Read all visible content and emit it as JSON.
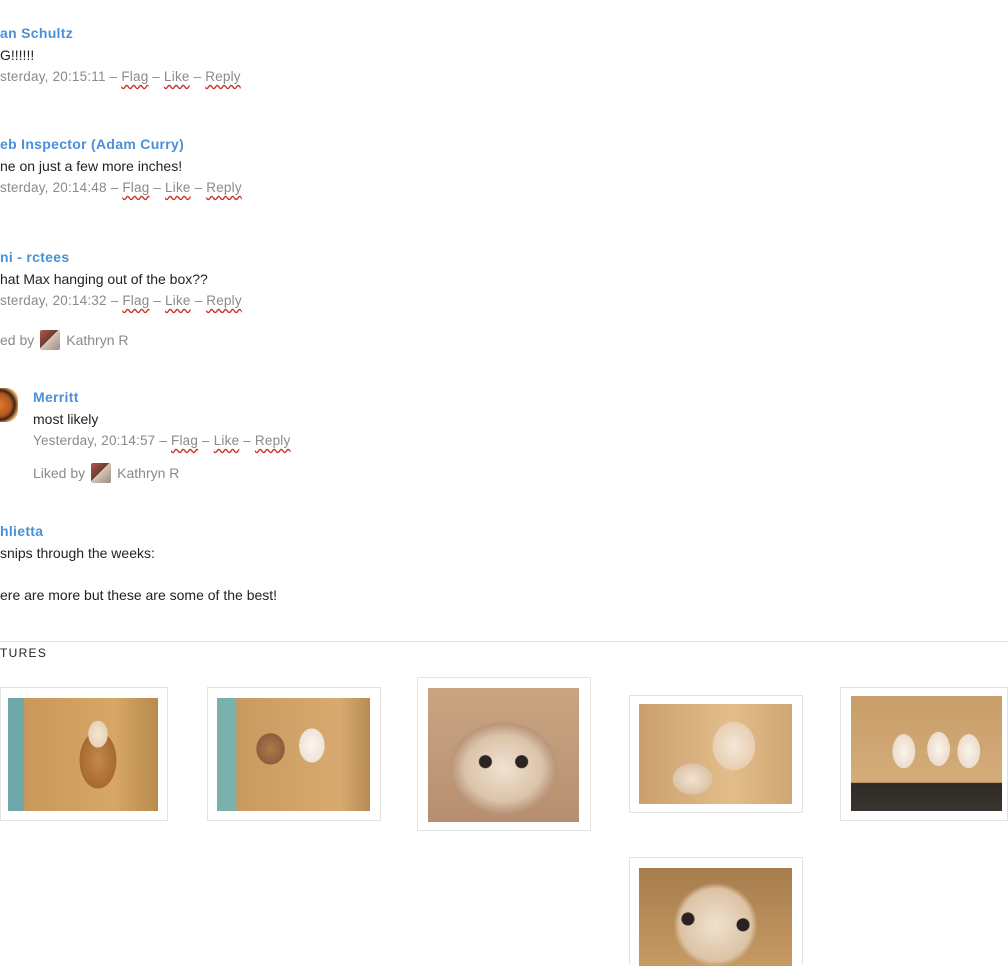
{
  "comments": [
    {
      "author": "an Schultz",
      "text": "G!!!!!!",
      "time": "sterday, 20:15:11",
      "flag": "Flag",
      "like": "Like",
      "reply": "Reply"
    },
    {
      "author": "eb Inspector (Adam Curry)",
      "text": "ne on just a few more inches!",
      "time": "sterday, 20:14:48",
      "flag": "Flag",
      "like": "Like",
      "reply": "Reply"
    },
    {
      "author": "ni - rctees",
      "text": "hat Max hanging out of the box??",
      "time": "sterday, 20:14:32",
      "flag": "Flag",
      "like": "Like",
      "reply": "Reply",
      "liked_prefix": "ed by",
      "liked_user": "Kathryn R"
    },
    {
      "author": "Merritt",
      "text": "most likely",
      "time": "Yesterday, 20:14:57",
      "flag": "Flag",
      "like": "Like",
      "reply": "Reply",
      "liked_prefix": "Liked by",
      "liked_user": "Kathryn R"
    },
    {
      "author": "hlietta",
      "text": "snips through the weeks:",
      "text2": "ere are more but these are some of the best!"
    }
  ],
  "separator": "–",
  "pictures": {
    "title": "TURES",
    "items": [
      {
        "name": "owl-photo-1"
      },
      {
        "name": "owl-photo-2"
      },
      {
        "name": "owl-photo-3"
      },
      {
        "name": "owl-photo-4"
      },
      {
        "name": "owl-photo-5"
      },
      {
        "name": "owl-photo-6"
      }
    ]
  }
}
